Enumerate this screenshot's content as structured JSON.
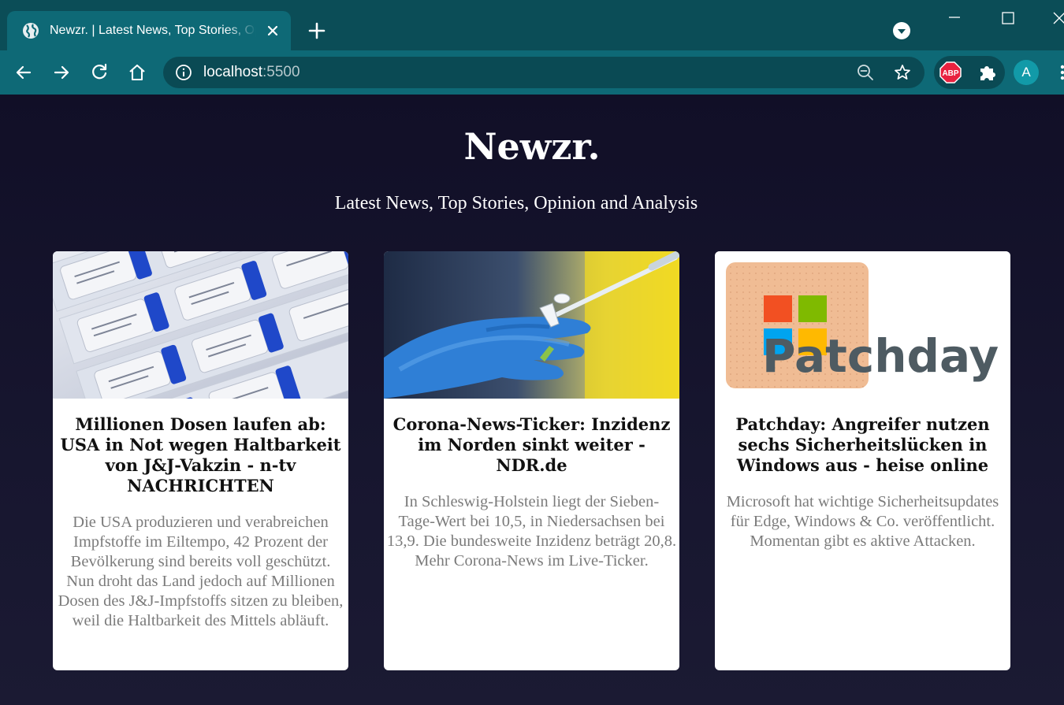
{
  "browser": {
    "tab_title": "Newzr. | Latest News, Top Stories, Opinion and Analysis",
    "url_host": "localhost",
    "url_port": ":5500",
    "profile_initial": "A",
    "extension_label": "ABP",
    "icons": [
      "globe-icon",
      "close-icon",
      "plus-icon",
      "tab-search-icon",
      "minimize-icon",
      "maximize-icon",
      "back-icon",
      "forward-icon",
      "reload-icon",
      "home-icon",
      "info-icon",
      "zoom-out-icon",
      "star-icon",
      "adblock-plus-icon",
      "puzzle-icon",
      "menu-icon"
    ]
  },
  "site": {
    "title": "Newzr.",
    "subtitle": "Latest News, Top Stories, Opinion and Analysis"
  },
  "articles": [
    {
      "title": "Millionen Dosen laufen ab: USA in Not wegen Haltbarkeit von J&J-Vakzin - n-tv NACHRICHTEN",
      "description": "Die USA produzieren und verabreichen Impfstoffe im Eiltempo, 42 Prozent der Bevölkerung sind bereits voll geschützt. Nun droht das Land jedoch auf Millionen Dosen des J&J-Impfstoffs sitzen zu bleiben, weil die Haltbarkeit des Mittels abläuft."
    },
    {
      "title": "Corona-News-Ticker: Inzidenz im Norden sinkt weiter - NDR.de",
      "description": "In Schleswig-Holstein liegt der Sieben-Tage-Wert bei 10,5, in Niedersachsen bei 13,9. Die bundesweite Inzidenz beträgt 20,8. Mehr Corona-News im Live-Ticker."
    },
    {
      "title": "Patchday: Angreifer nutzen sechs Sicherheitslücken in Windows aus - heise online",
      "description": "Microsoft hat wichtige Sicherheitsupdates für Edge, Windows & Co. veröffentlicht. Momentan gibt es aktive Attacken.",
      "image_text": "Patchday"
    }
  ],
  "colors": {
    "tabbar": "#0b4d57",
    "toolbar": "#0e6976",
    "page_background": "#15132b",
    "card_background": "#ffffff",
    "description_text": "#7b7b7b"
  }
}
